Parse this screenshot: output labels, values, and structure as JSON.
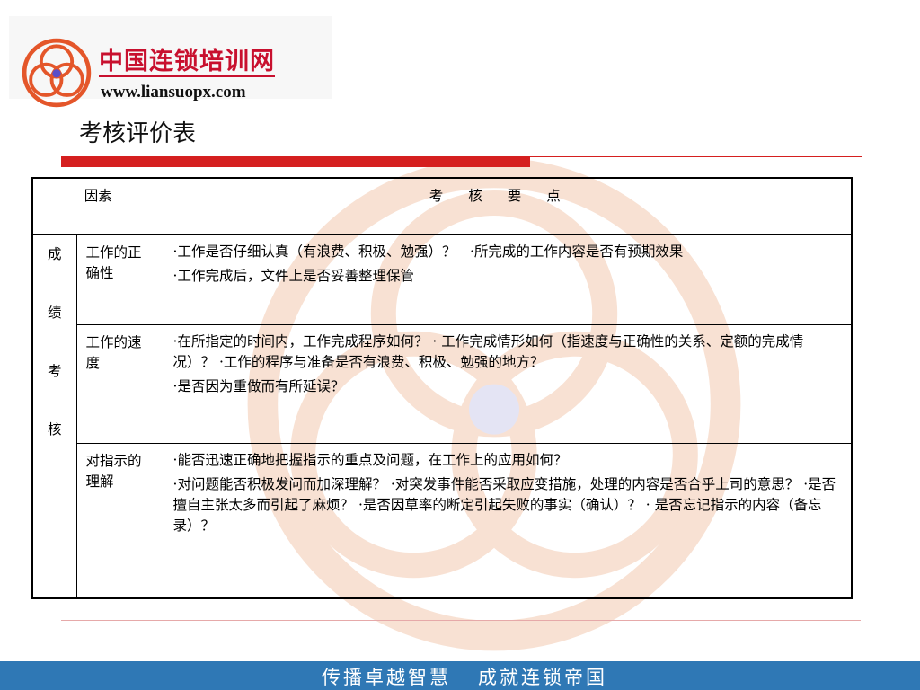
{
  "logo": {
    "name_cn": "中国连锁培训网",
    "url": "www.liansuopx.com"
  },
  "title": "考核评价表",
  "table": {
    "headers": {
      "factor": "因素",
      "points": "考核要点"
    },
    "category_chars": [
      "成",
      "绩",
      "考",
      "核"
    ],
    "rows": [
      {
        "factor": "工作的正确性",
        "points": [
          "·工作是否仔细认真（有浪费、积极、勉强）？　·所完成的工作内容是否有预期效果",
          "·工作完成后，文件上是否妥善整理保管"
        ]
      },
      {
        "factor": "工作的速度",
        "points": [
          "·在所指定的时间内，工作完成程序如何？ · 工作完成情形如何（指速度与正确性的关系、定额的完成情况）？ ·工作的程序与准备是否有浪费、积极、勉强的地方？",
          "·是否因为重做而有所延误？"
        ]
      },
      {
        "factor": "对指示的理解",
        "points": [
          "·能否迅速正确地把握指示的重点及问题，在工作上的应用如何？",
          "·对问题能否积极发问而加深理解？ ·对突发事件能否采取应变措施，处理的内容是否合乎上司的意思？ ·是否擅自主张太多而引起了麻烦？ ·是否因草率的断定引起失败的事实（确认）？ · 是否忘记指示的内容（备忘录）？"
        ]
      }
    ]
  },
  "footer": {
    "left": "传播卓越智慧",
    "right": "成就连锁帝国"
  },
  "colors": {
    "brand_red": "#c8102e",
    "rule_red": "#d51f1f",
    "footer_blue": "#2f78b5"
  }
}
